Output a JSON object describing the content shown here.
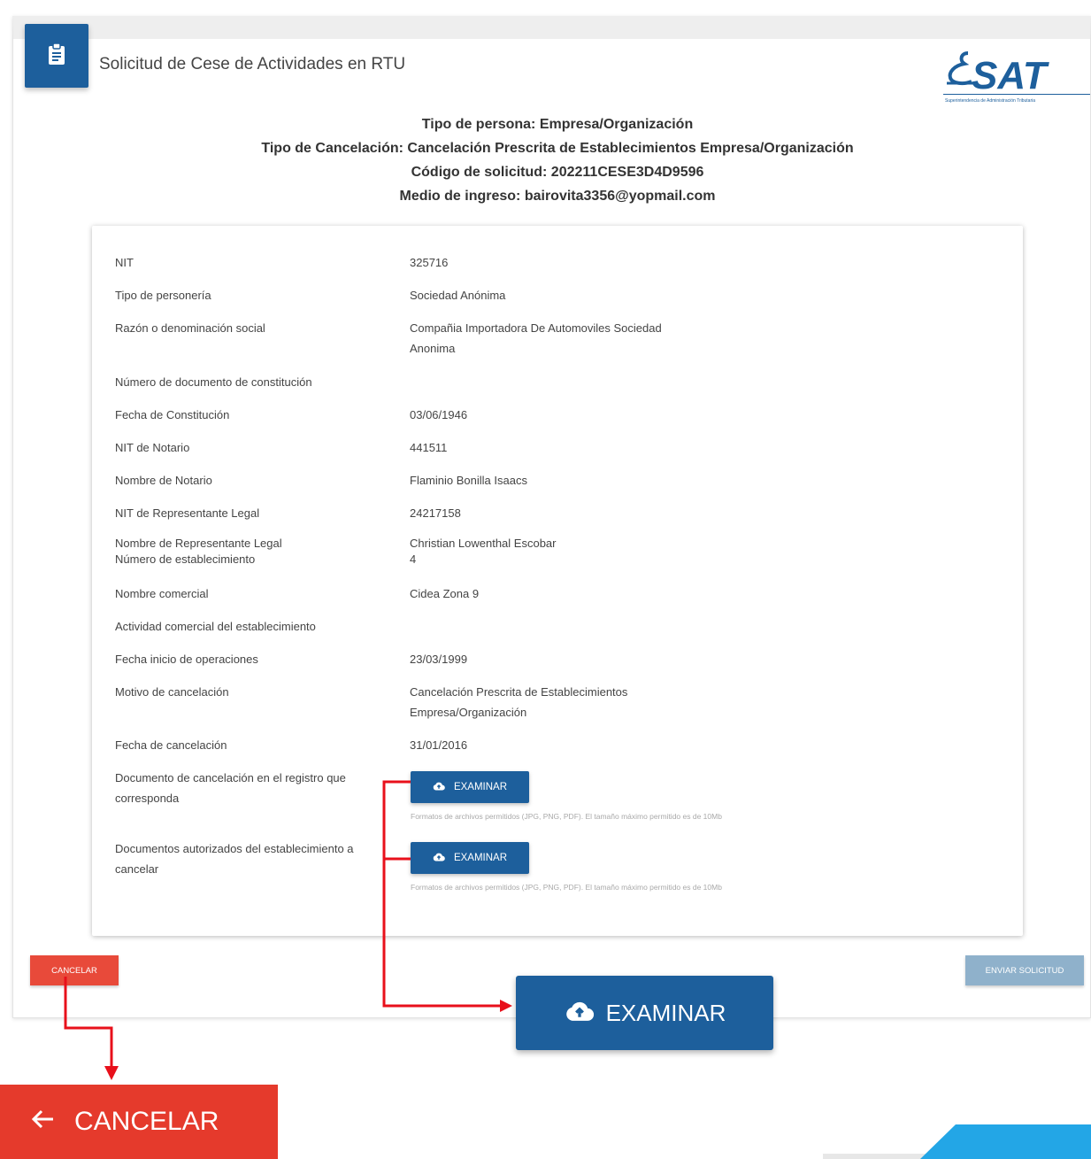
{
  "header": {
    "title": "Solicitud de Cese de Actividades en RTU",
    "icon": "clipboard-icon",
    "logo_text": "SAT",
    "logo_subtext": "Superintendencia de Administración Tributaria"
  },
  "info": {
    "line1": "Tipo de persona: Empresa/Organización",
    "line2": "Tipo de Cancelación: Cancelación Prescrita de Establecimientos Empresa/Organización",
    "line3": "Código de solicitud: 202211CESE3D4D9596",
    "line4": "Medio de ingreso: bairovita3356@yopmail.com"
  },
  "fields": [
    {
      "label": "NIT",
      "value": "325716"
    },
    {
      "label": "Tipo de personería",
      "value": "Sociedad Anónima"
    },
    {
      "label": "Razón o denominación social",
      "value": "Compañia Importadora De Automoviles Sociedad Anonima"
    },
    {
      "label": "Número de documento de constitución",
      "value": ""
    },
    {
      "label": "Fecha de Constitución",
      "value": "03/06/1946"
    },
    {
      "label": "NIT de Notario",
      "value": "441511"
    },
    {
      "label": "Nombre de Notario",
      "value": "Flaminio Bonilla Isaacs"
    },
    {
      "label": "NIT de Representante Legal",
      "value": "24217158"
    },
    {
      "label": "Nombre de Representante Legal",
      "value": "Christian Lowenthal Escobar"
    },
    {
      "label": "Número de establecimiento",
      "value": "4"
    },
    {
      "label": "Nombre comercial",
      "value": "Cidea Zona 9"
    },
    {
      "label": "Actividad comercial del establecimiento",
      "value": ""
    },
    {
      "label": "Fecha inicio de operaciones",
      "value": "23/03/1999"
    },
    {
      "label": "Motivo de cancelación",
      "value": "Cancelación Prescrita de Establecimientos Empresa/Organización"
    },
    {
      "label": "Fecha de cancelación",
      "value": "31/01/2016"
    }
  ],
  "uploads": [
    {
      "label": "Documento de cancelación en el registro que corresponda",
      "button": "EXAMINAR",
      "hint": "Formatos de archivos permitidos (JPG, PNG, PDF). El tamaño máximo permitido es de 10Mb"
    },
    {
      "label": "Documentos autorizados del establecimiento a cancelar",
      "button": "EXAMINAR",
      "hint": "Formatos de archivos permitidos (JPG, PNG, PDF). El tamaño máximo permitido es de 10Mb"
    }
  ],
  "actions": {
    "cancel": "CANCELAR",
    "send": "ENVIAR SOLICITUD"
  },
  "zoom": {
    "examinar": "EXAMINAR",
    "cancel": "CANCELAR"
  },
  "colors": {
    "primary": "#1d5f9c",
    "danger": "#e84a3a",
    "disabled": "#8fb1cb",
    "annotation": "#e8101b"
  }
}
